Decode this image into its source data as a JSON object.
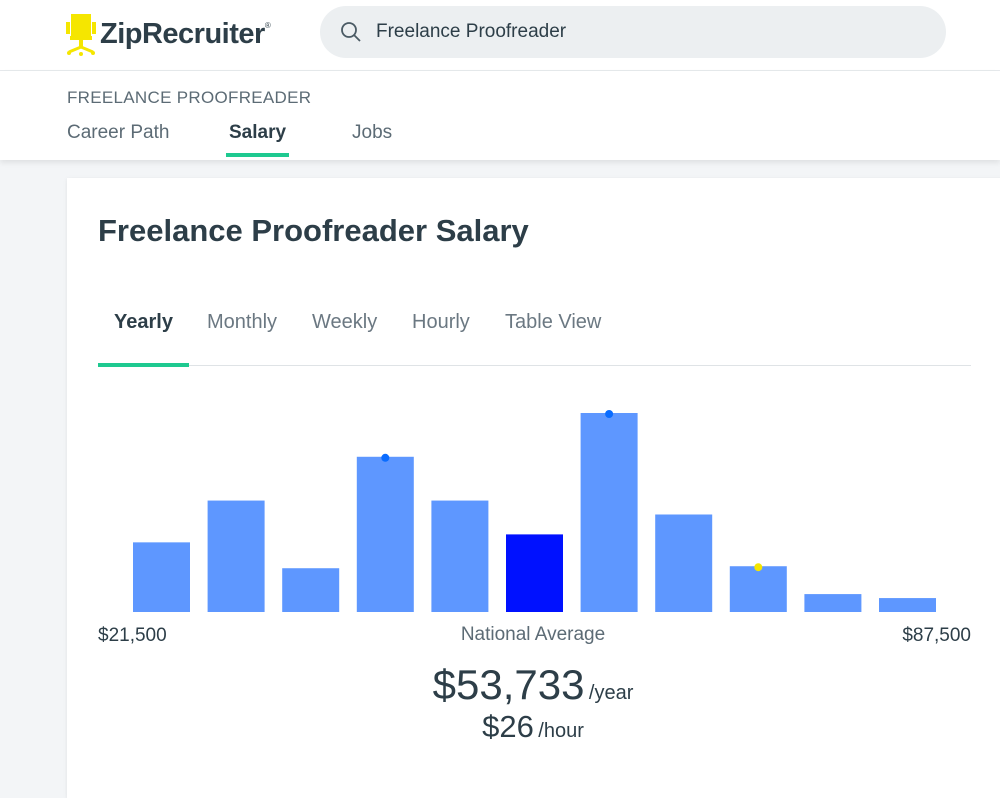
{
  "header": {
    "logo_text": "ZipRecruiter",
    "logo_mark": "®",
    "search_value": "Freelance Proofreader",
    "search_icon": "search-icon"
  },
  "subnav": {
    "breadcrumb": "FREELANCE PROOFREADER",
    "tabs": [
      {
        "label": "Career Path",
        "active": false
      },
      {
        "label": "Salary",
        "active": true
      },
      {
        "label": "Jobs",
        "active": false
      }
    ]
  },
  "main": {
    "title": "Freelance Proofreader Salary",
    "tabs": [
      {
        "label": "Yearly",
        "active": true
      },
      {
        "label": "Monthly",
        "active": false
      },
      {
        "label": "Weekly",
        "active": false
      },
      {
        "label": "Hourly",
        "active": false
      },
      {
        "label": "Table View",
        "active": false
      }
    ],
    "range_min": "$21,500",
    "range_max": "$87,500",
    "average_label": "National Average",
    "average_yearly": "$53,733",
    "yearly_unit": "/year",
    "average_hourly": "$26",
    "hourly_unit": "/hour"
  },
  "chart_data": {
    "type": "bar",
    "x_range": [
      "$21,500",
      "$87,500"
    ],
    "relative_values": [
      35,
      56,
      22,
      78,
      56,
      39,
      100,
      49,
      23,
      9,
      7
    ],
    "highlight_index": 5,
    "markers": [
      {
        "index": 3,
        "color": "#0a6cff"
      },
      {
        "index": 6,
        "color": "#0a6cff"
      },
      {
        "index": 8,
        "color": "#f5e600"
      }
    ],
    "colors": {
      "bar": "#5e97ff",
      "highlight": "#0011ff"
    },
    "grid": false
  },
  "colors": {
    "accent": "#1ec990",
    "logo": "#f5e600",
    "text": "#2d3e48"
  }
}
